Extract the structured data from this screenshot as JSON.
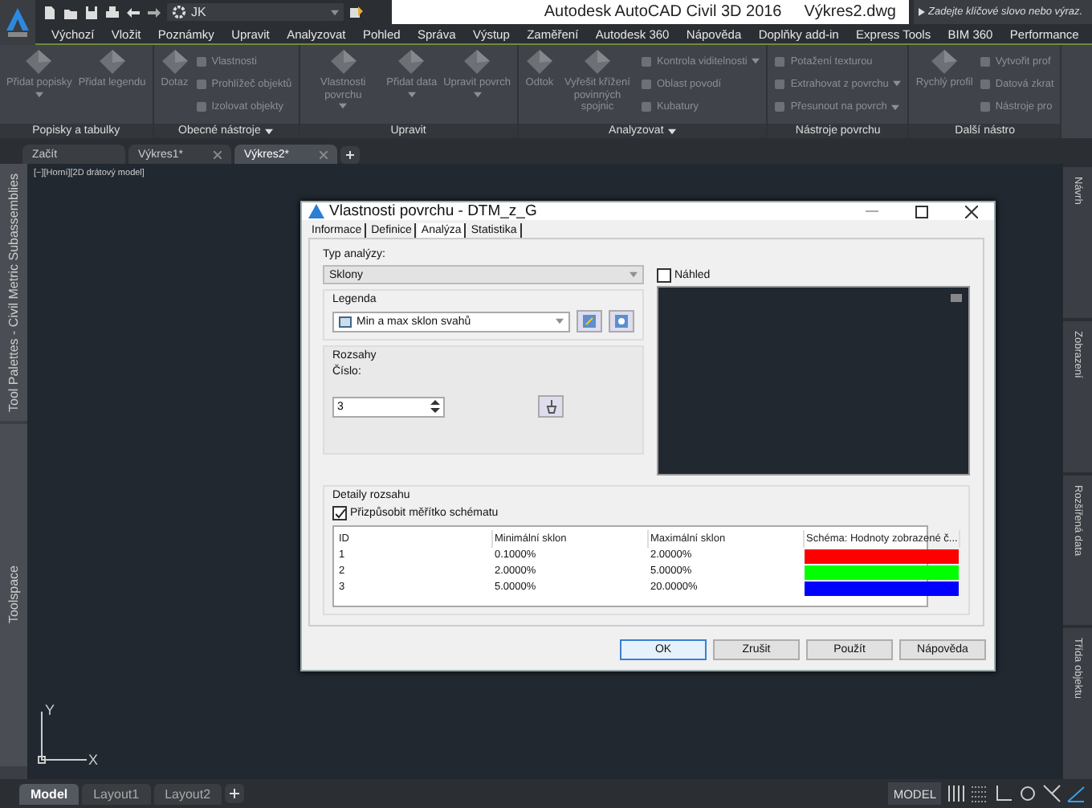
{
  "app": {
    "title": "Autodesk AutoCAD Civil 3D 2016",
    "document": "Výkres2.dwg",
    "workspace": "JK",
    "search": {
      "placeholder": "Zadejte klíčové slovo nebo výraz."
    }
  },
  "ribbon_tabs": [
    "Výchozí",
    "Vložit",
    "Poznámky",
    "Upravit",
    "Analyzovat",
    "Pohled",
    "Správa",
    "Výstup",
    "Zaměření",
    "Autodesk 360",
    "Nápověda",
    "Doplňky add-in",
    "Express Tools",
    "BIM 360",
    "Performance"
  ],
  "ribbon_panels": [
    {
      "title": "Popisky a tabulky",
      "menu": false,
      "tools": [
        {
          "kind": "large",
          "label": "Přidat popisky",
          "dropdown": true
        },
        {
          "kind": "large",
          "label": "Přidat legendu",
          "dropdown": false
        }
      ]
    },
    {
      "title": "Obecné nástroje",
      "menu": true,
      "tools": [
        {
          "kind": "large",
          "label": "Dotaz",
          "dropdown": false
        },
        {
          "kind": "small",
          "label": "Vlastnosti",
          "dropdown": false
        },
        {
          "kind": "small",
          "label": "Prohlížeč objektů",
          "dropdown": false
        },
        {
          "kind": "small",
          "label": "Izolovat objekty",
          "dropdown": false
        }
      ]
    },
    {
      "title": "Upravit",
      "menu": false,
      "tools": [
        {
          "kind": "large",
          "label": "Vlastnosti povrchu",
          "dropdown": true
        },
        {
          "kind": "large",
          "label": "Přidat data",
          "dropdown": true
        },
        {
          "kind": "large",
          "label": "Upravit povrch",
          "dropdown": true
        }
      ]
    },
    {
      "title": "Analyzovat",
      "menu": true,
      "tools": [
        {
          "kind": "large",
          "label": "Odtok",
          "dropdown": false
        },
        {
          "kind": "large",
          "label": "Vyřešit křížení povinných spojnic",
          "dropdown": false
        },
        {
          "kind": "small",
          "label": "Kontrola viditelnosti",
          "dropdown": true
        },
        {
          "kind": "small",
          "label": "Oblast povodí",
          "dropdown": false
        },
        {
          "kind": "small",
          "label": "Kubatury",
          "dropdown": false
        }
      ]
    },
    {
      "title": "Nástroje povrchu",
      "menu": false,
      "tools": [
        {
          "kind": "small",
          "label": "Potažení texturou",
          "dropdown": false
        },
        {
          "kind": "small",
          "label": "Extrahovat z povrchu",
          "dropdown": true
        },
        {
          "kind": "small",
          "label": "Přesunout na povrch",
          "dropdown": true
        }
      ]
    },
    {
      "title": "Další nástro",
      "menu": false,
      "tools": [
        {
          "kind": "large",
          "label": "Rychlý profil",
          "dropdown": false
        },
        {
          "kind": "small",
          "label": "Vytvořit prof",
          "dropdown": false
        },
        {
          "kind": "small",
          "label": "Datová zkrat",
          "dropdown": false
        },
        {
          "kind": "small",
          "label": "Nástroje pro",
          "dropdown": false
        }
      ]
    }
  ],
  "document_tabs": [
    {
      "label": "Začít",
      "closable": false,
      "selected": false
    },
    {
      "label": "Výkres1*",
      "closable": true,
      "selected": false
    },
    {
      "label": "Výkres2*",
      "closable": true,
      "selected": true
    }
  ],
  "viewport": {
    "label": "[−][Horní][2D drátový model]",
    "ucs_y": "Y",
    "ucs_x": "X"
  },
  "left_palettes": [
    "Tool Palettes - Civil Metric Subassemblies",
    "Toolspace"
  ],
  "right_palette_tabs": [
    "Návrh",
    "Zobrazení",
    "Rozšířená data",
    "Třída objektu"
  ],
  "dialog": {
    "title": "Vlastnosti povrchu - DTM_z_G",
    "tabs": [
      {
        "label": "Informace",
        "selected": false
      },
      {
        "label": "Definice",
        "selected": false
      },
      {
        "label": "Analýza",
        "selected": true
      },
      {
        "label": "Statistika",
        "selected": false
      }
    ],
    "analysis_type": {
      "label": "Typ analýzy:",
      "value": "Sklony"
    },
    "legend": {
      "label": "Legenda",
      "value": "Min a max sklon svahů"
    },
    "ranges": {
      "label": "Rozsahy",
      "number_label": "Číslo:",
      "number": "3"
    },
    "preview": {
      "label": "Náhled",
      "checked": false
    },
    "range_details": {
      "label": "Detaily rozsahu",
      "scale_to_fit": {
        "label": "Přizpůsobit měřítko schématu",
        "checked": true
      },
      "columns": [
        "ID",
        "Minimální sklon",
        "Maximální sklon",
        "Schéma: Hodnoty zobrazené č..."
      ],
      "rows": [
        {
          "id": "1",
          "min": "0.1000%",
          "max": "2.0000%",
          "color": "#ff0000"
        },
        {
          "id": "2",
          "min": "2.0000%",
          "max": "5.0000%",
          "color": "#00ff00"
        },
        {
          "id": "3",
          "min": "5.0000%",
          "max": "20.0000%",
          "color": "#0000ff"
        }
      ]
    },
    "buttons": [
      {
        "label": "OK",
        "default": true
      },
      {
        "label": "Zrušit",
        "default": false
      },
      {
        "label": "Použít",
        "default": false
      },
      {
        "label": "Nápověda",
        "default": false
      }
    ]
  },
  "layout_tabs": [
    {
      "label": "Model",
      "selected": true
    },
    {
      "label": "Layout1",
      "selected": false
    },
    {
      "label": "Layout2",
      "selected": false
    }
  ],
  "status_bar": {
    "mode": "MODEL"
  }
}
